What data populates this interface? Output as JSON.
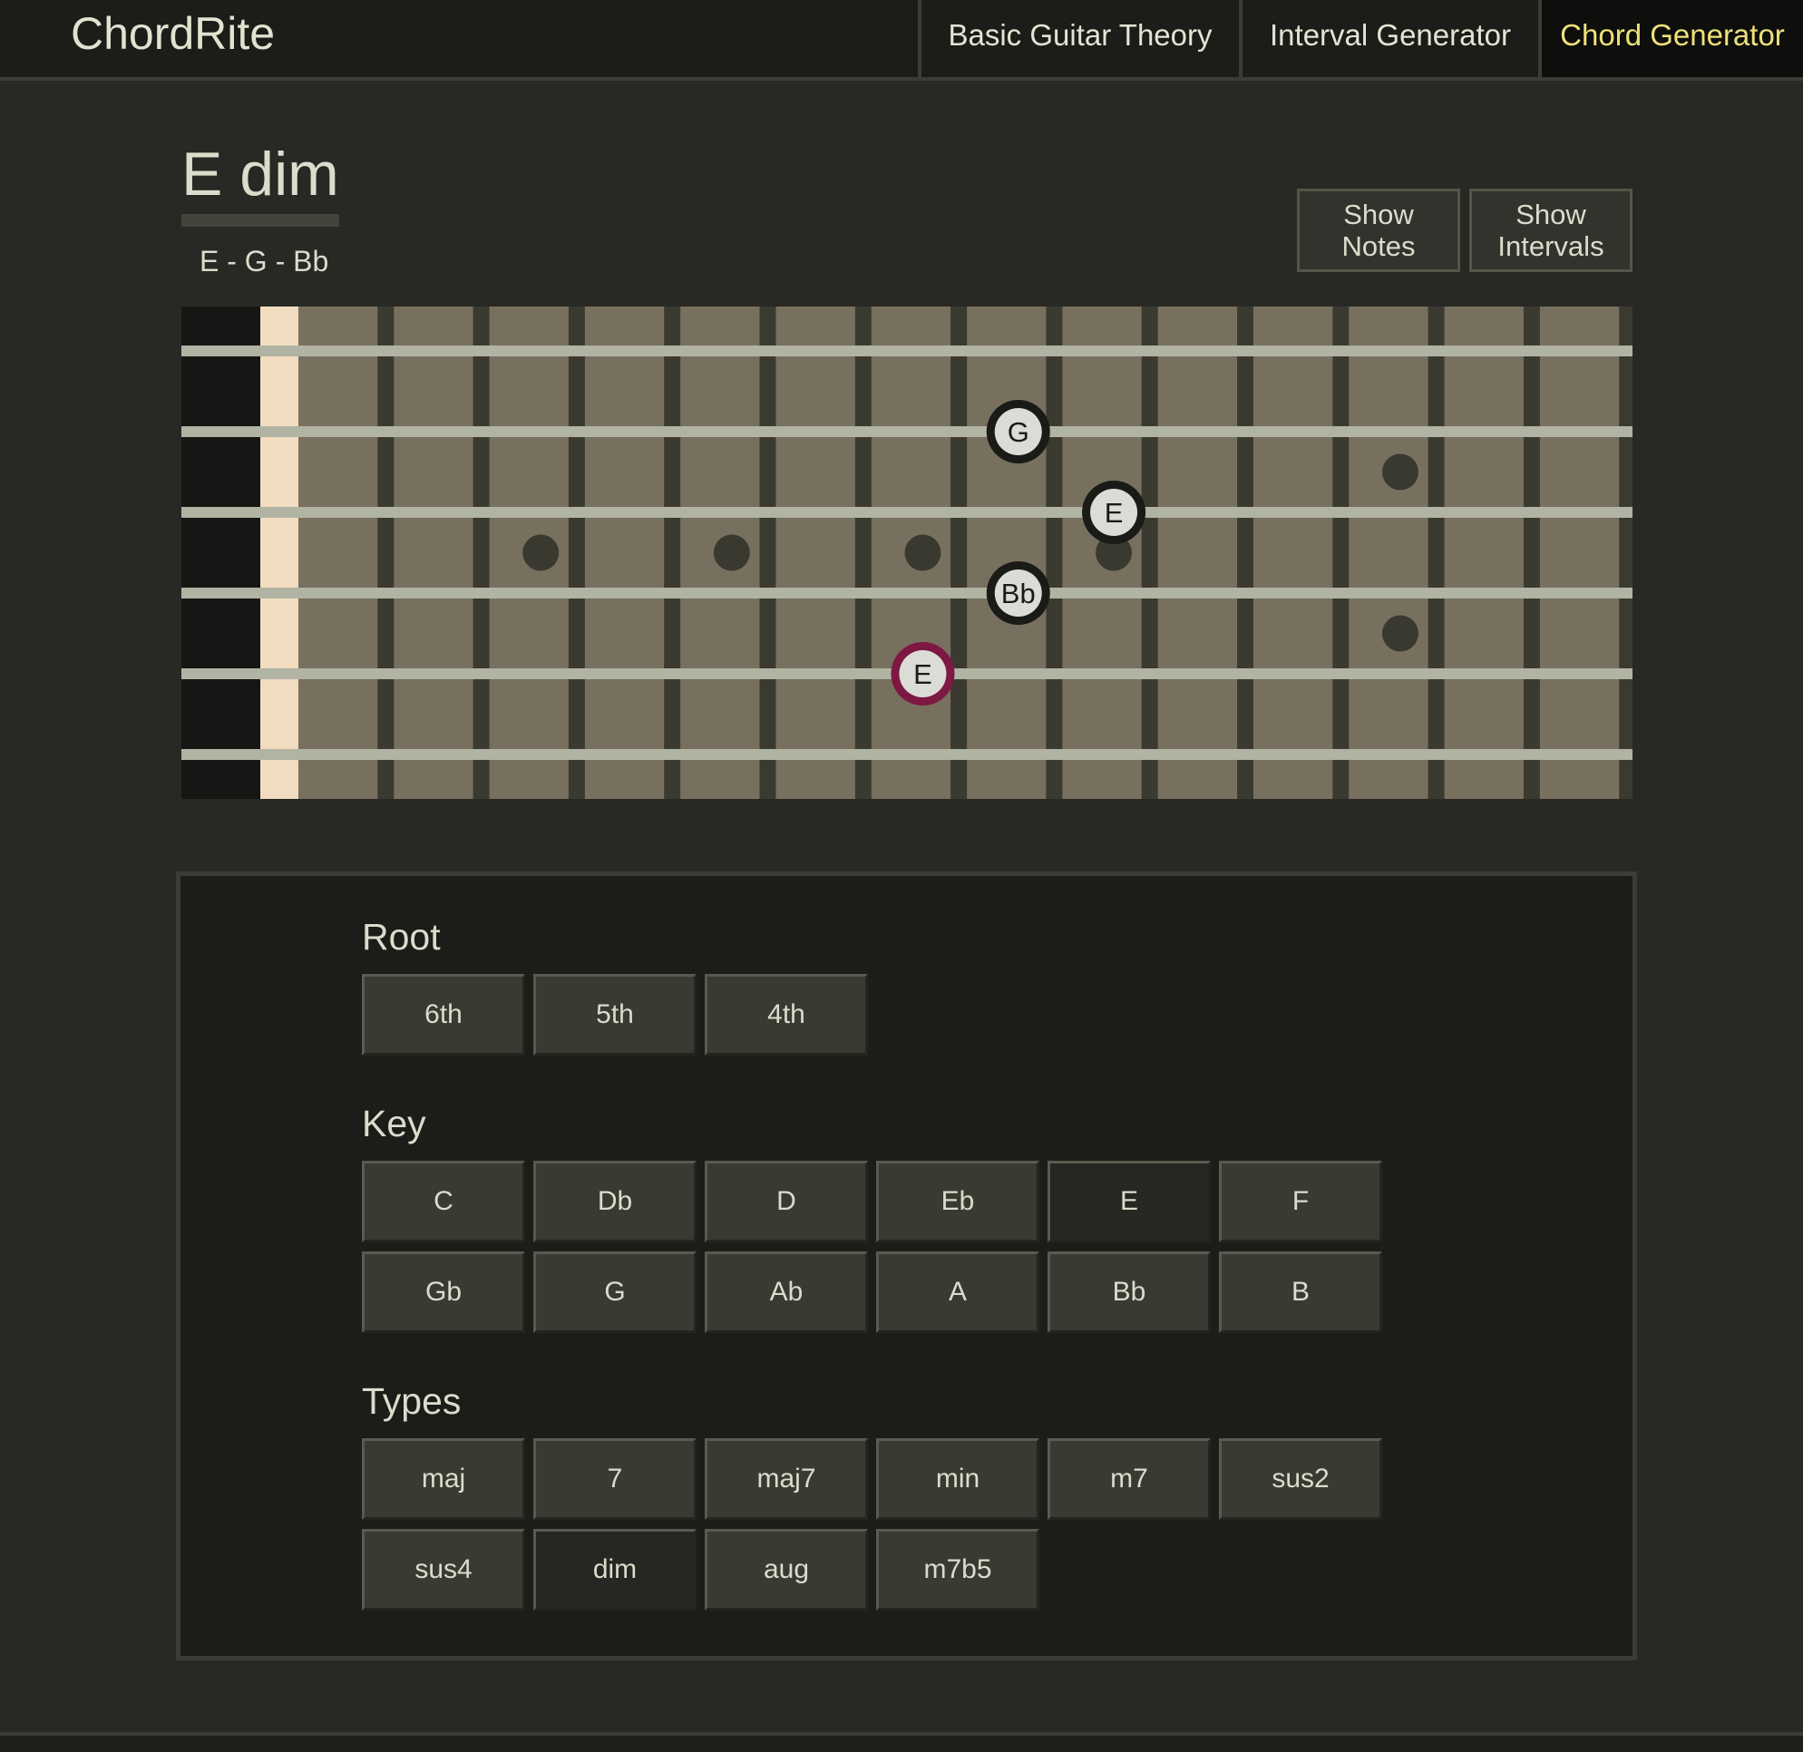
{
  "app": {
    "title": "ChordRite"
  },
  "nav": {
    "tabs": [
      {
        "label": "Basic Guitar Theory",
        "active": false
      },
      {
        "label": "Interval Generator",
        "active": false
      },
      {
        "label": "Chord Generator",
        "active": true
      }
    ]
  },
  "chord": {
    "name": "E dim",
    "notes": "E - G - Bb"
  },
  "toggles": {
    "show_notes": "Show Notes",
    "show_intervals": "Show Intervals"
  },
  "fretboard": {
    "strings": 6,
    "frets": 14,
    "inlays": [
      {
        "fret": 3,
        "position": "center"
      },
      {
        "fret": 5,
        "position": "center"
      },
      {
        "fret": 7,
        "position": "center"
      },
      {
        "fret": 9,
        "position": "center"
      },
      {
        "fret": 12,
        "position": "double"
      },
      {
        "fret": 15,
        "position": "center"
      }
    ],
    "markers": [
      {
        "note": "G",
        "string": 2,
        "fret": 8,
        "root": false
      },
      {
        "note": "E",
        "string": 3,
        "fret": 9,
        "root": false
      },
      {
        "note": "Bb",
        "string": 4,
        "fret": 8,
        "root": false
      },
      {
        "note": "E",
        "string": 5,
        "fret": 7,
        "root": true
      }
    ],
    "colors": {
      "nut": "#f1dcc0",
      "board": "#78705f",
      "fret_wire": "#3b3a31",
      "string": "#b1b3a3",
      "root_ring": "#7c1842",
      "marker_ring": "#1a1a17",
      "marker_fill": "#dcdcd6"
    }
  },
  "controls": {
    "root": {
      "title": "Root",
      "options": [
        "6th",
        "5th",
        "4th"
      ]
    },
    "key": {
      "title": "Key",
      "options": [
        "C",
        "Db",
        "D",
        "Eb",
        "E",
        "F",
        "Gb",
        "G",
        "Ab",
        "A",
        "Bb",
        "B"
      ],
      "selected": "E"
    },
    "types": {
      "title": "Types",
      "options": [
        "maj",
        "7",
        "maj7",
        "min",
        "m7",
        "sus2",
        "sus4",
        "dim",
        "aug",
        "m7b5"
      ],
      "selected": "dim"
    }
  }
}
